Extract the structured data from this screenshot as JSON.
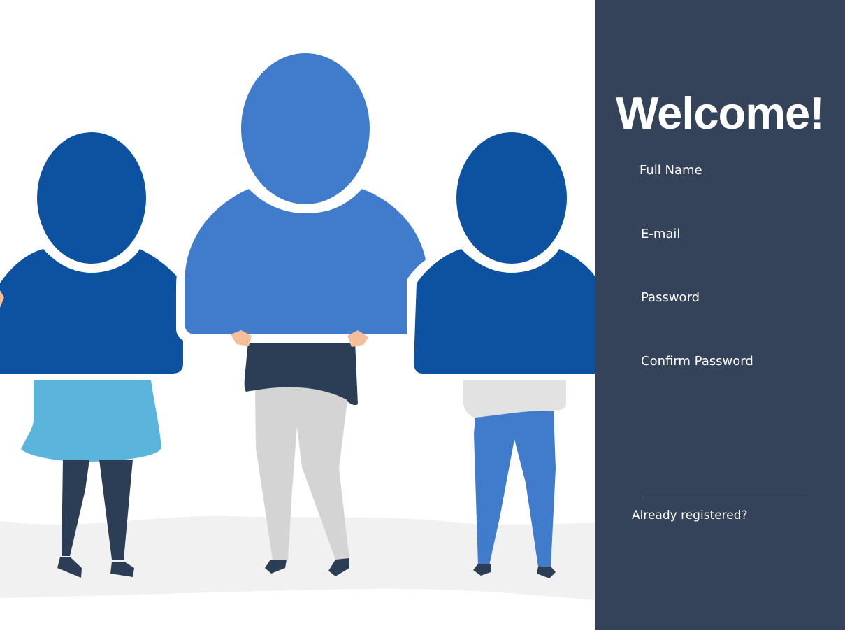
{
  "panel": {
    "title": "Welcome!",
    "fields": [
      {
        "label": "Full Name",
        "value": ""
      },
      {
        "label": "E-mail",
        "value": ""
      },
      {
        "label": "Password",
        "value": ""
      },
      {
        "label": "Confirm Password",
        "value": ""
      }
    ],
    "login_link": "Already registered?"
  },
  "colors": {
    "panel_bg": "#34435a",
    "text": "#ffffff",
    "blue_dark": "#0c52a0",
    "blue_light": "#417ccc",
    "skirt": "#5ab4dc",
    "navy": "#2c3e55",
    "grey_pants": "#d4d4d4",
    "ground": "#f1f1f1",
    "skin": "#f5bf9b"
  },
  "illustration": {
    "icon": "people-holding-user-icons-illustration"
  }
}
